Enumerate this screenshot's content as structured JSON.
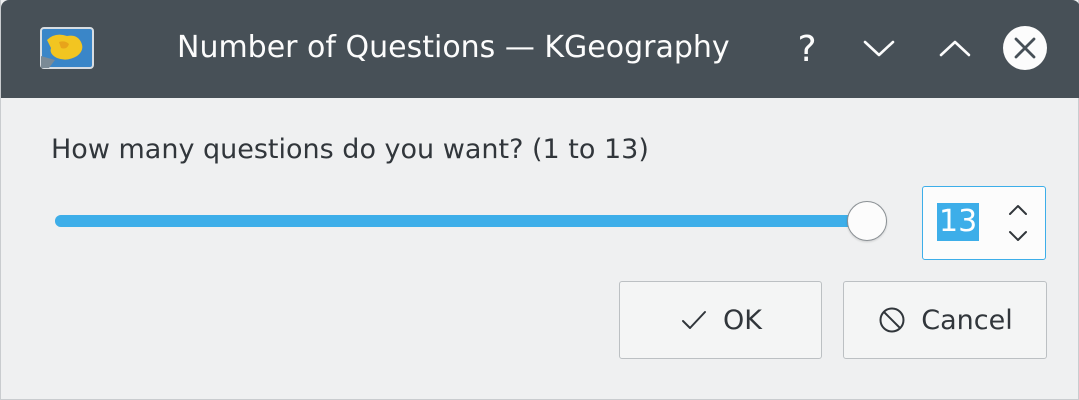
{
  "window": {
    "title": "Number of Questions — KGeography",
    "app_icon": "kgeography-icon",
    "controls": {
      "help_label": "?",
      "help_icon": "help-icon",
      "minimize_icon": "chevron-down-icon",
      "maximize_icon": "chevron-up-icon",
      "close_icon": "close-icon"
    }
  },
  "dialog": {
    "prompt": "How many questions do you want? (1 to 13)",
    "slider": {
      "min": 1,
      "max": 13,
      "value": 13
    },
    "spinbox": {
      "value": "13"
    },
    "buttons": {
      "ok_label": "OK",
      "ok_icon": "checkmark-icon",
      "cancel_label": "Cancel",
      "cancel_icon": "cancel-icon"
    }
  },
  "colors": {
    "titlebar": "#475057",
    "background": "#eff0f1",
    "accent": "#3daee9",
    "text": "#31363b"
  }
}
